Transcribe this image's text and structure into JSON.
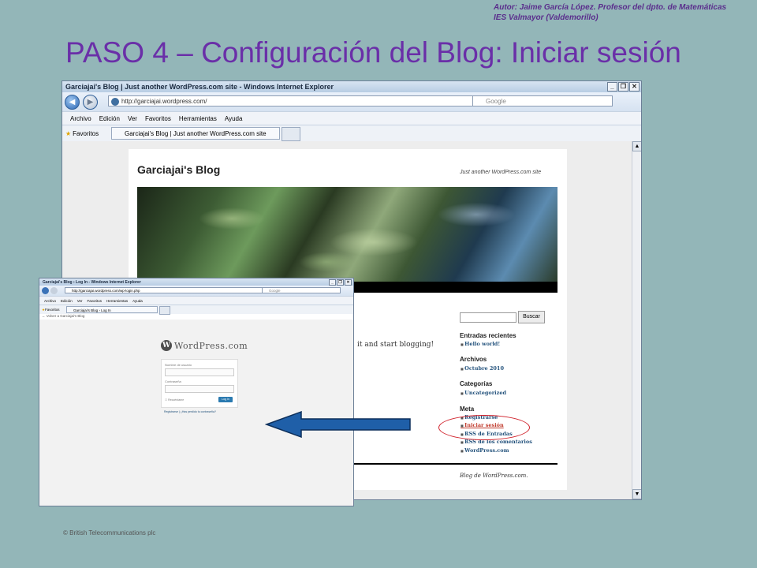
{
  "slide": {
    "author_line1": "Autor: Jaime García López. Profesor del dpto. de Matemáticas",
    "author_line2": "IES Valmayor (Valdemorillo)",
    "title": "PASO 4 – Configuración del Blog: Iniciar sesión",
    "copyright": "© British Telecommunications plc"
  },
  "browser": {
    "window_title": "Garciajai's Blog | Just another WordPress.com site - Windows Internet Explorer",
    "url": "http://garciajai.wordpress.com/",
    "search_placeholder": "Google",
    "menu": [
      "Archivo",
      "Edición",
      "Ver",
      "Favoritos",
      "Herramientas",
      "Ayuda"
    ],
    "favorites_label": "Favoritos",
    "tab_label": "Garciajai's Blog | Just another WordPress.com site"
  },
  "blog": {
    "title": "Garciajai's Blog",
    "tagline": "Just another WordPress.com site",
    "teaser": "it and start blogging!",
    "search_button": "Buscar",
    "sections": [
      {
        "heading": "Entradas recientes",
        "items": [
          "Hello world!"
        ]
      },
      {
        "heading": "Archivos",
        "items": [
          "Octubre 2010"
        ]
      },
      {
        "heading": "Categorías",
        "items": [
          "Uncategorized"
        ]
      },
      {
        "heading": "Meta",
        "items": [
          "Registrarse",
          "Iniciar sesión",
          "RSS de Entradas",
          "RSS de los comentarios",
          "WordPress.com"
        ]
      }
    ],
    "footer": "Blog de WordPress.com."
  },
  "login_window": {
    "window_title": "Garciajai's Blog › Log In - Windows Internet Explorer",
    "url": "http://garciajai.wordpress.com/wp-login.php",
    "search_placeholder": "Google",
    "menu": [
      "Archivo",
      "Edición",
      "Ver",
      "Favoritos",
      "Herramientas",
      "Ayuda"
    ],
    "favorites_label": "Favoritos",
    "tab_label": "Garciajai's Blog › Log In",
    "back_link": "← Volver a Garciajai's Blog",
    "logo_text": "WordPress.com",
    "username_label": "Nombre de usuario",
    "password_label": "Contraseña",
    "remember_label": "Recuérdame",
    "login_button": "Log In",
    "links": "Registrarse | ¿Has perdido tu contraseña?"
  },
  "colors": {
    "background": "#93b6b8",
    "title": "#6a2fa8",
    "arrow": "#1f5fa8",
    "highlight_circle": "#d0202a"
  }
}
